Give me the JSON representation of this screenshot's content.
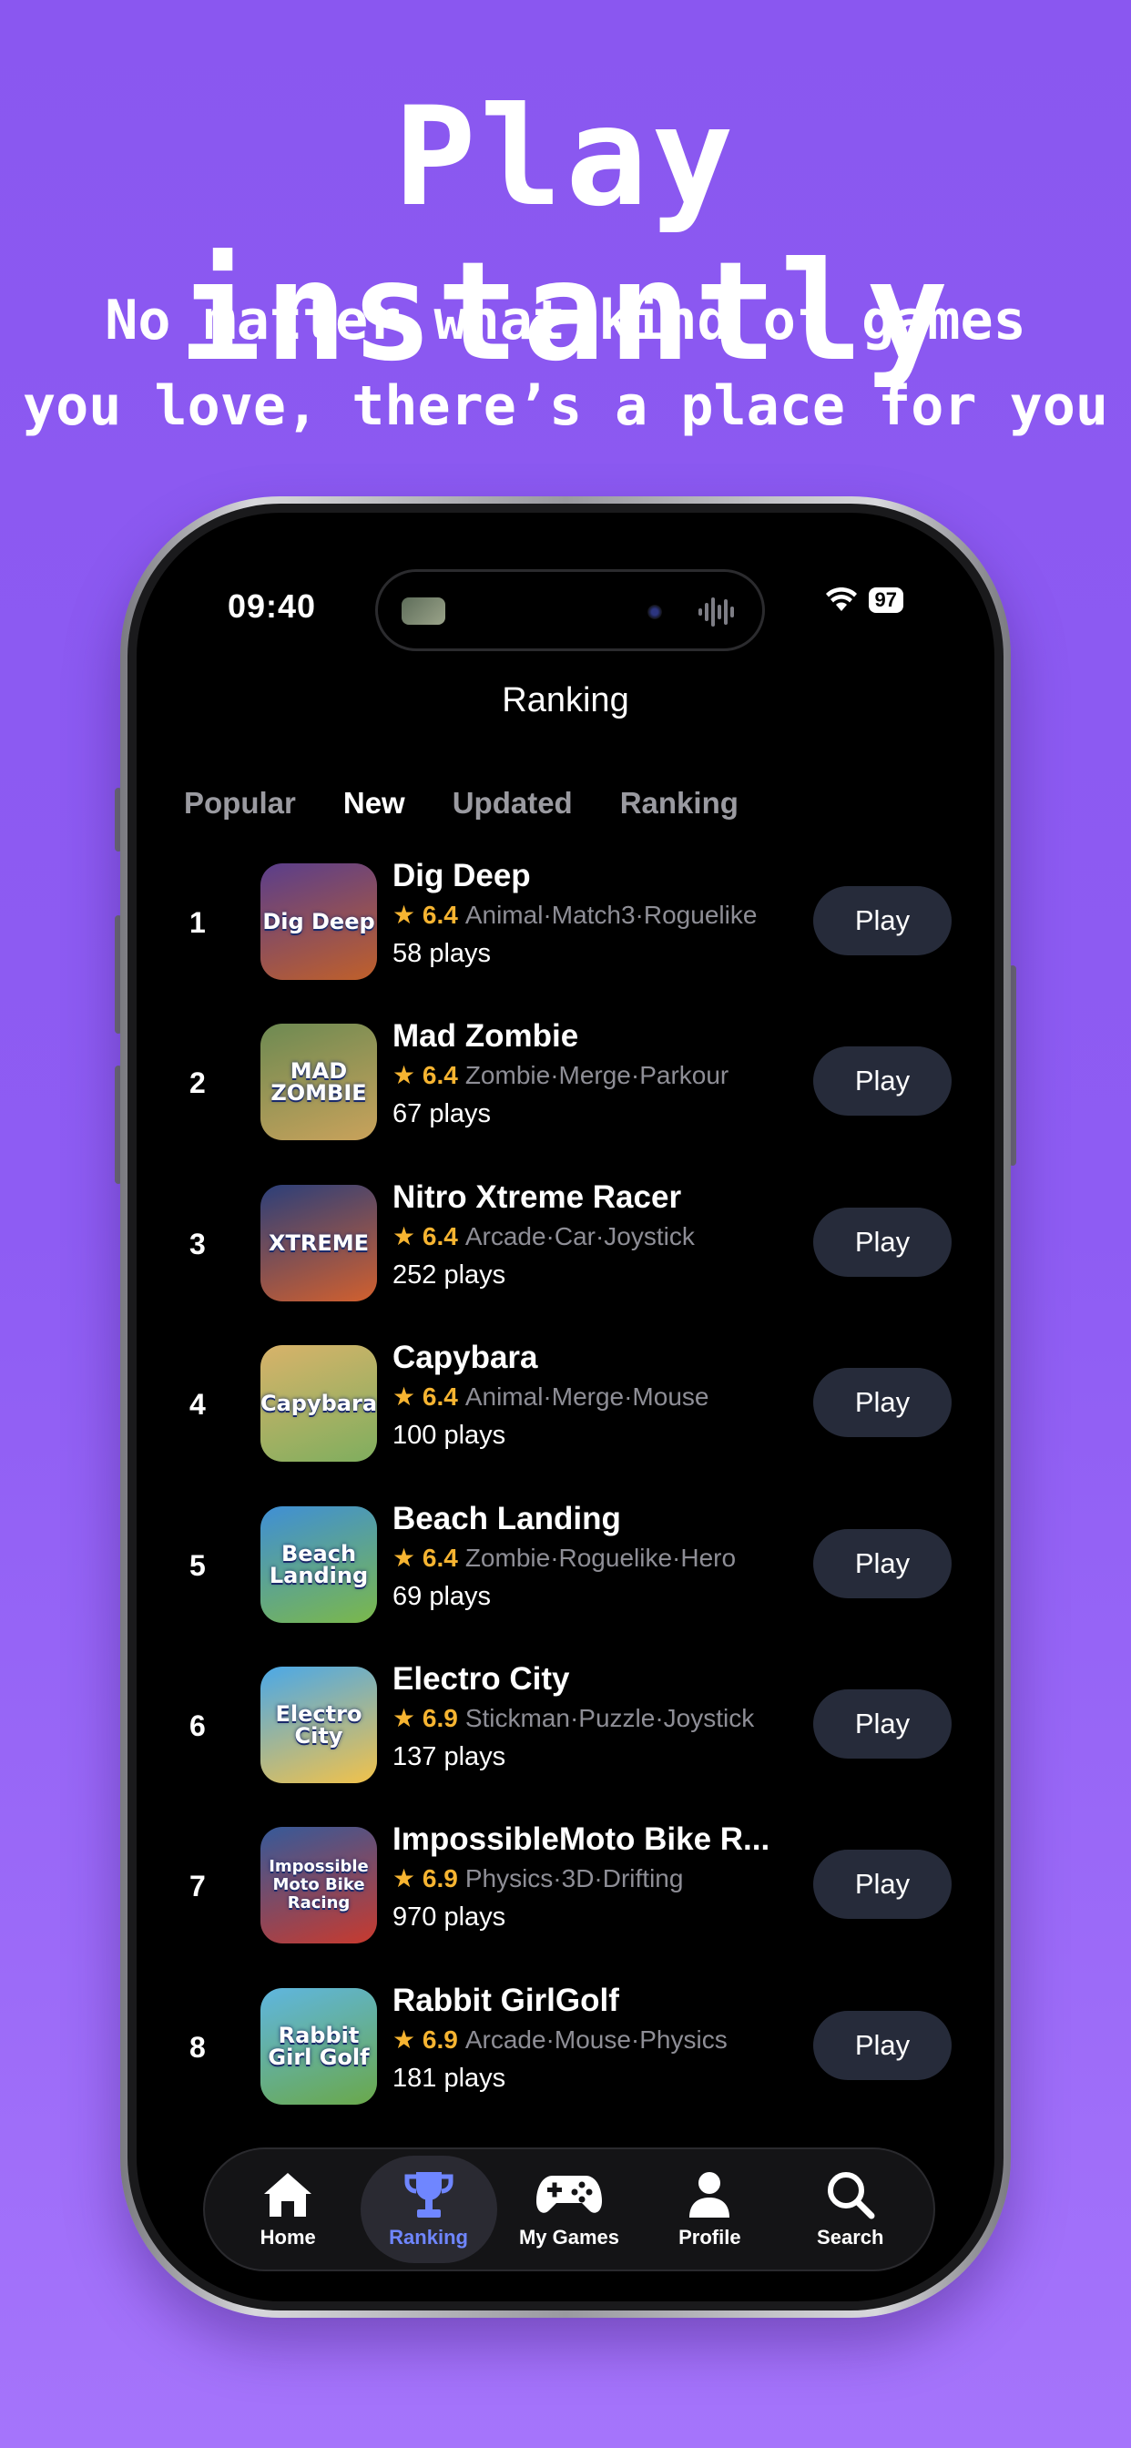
{
  "headline": "Play instantly",
  "subheadline_line1": "No matter what kind of games",
  "subheadline_line2": "you love, there’s a place for you",
  "status_bar": {
    "time": "09:40",
    "battery": "97"
  },
  "nav": {
    "title": "Ranking"
  },
  "tabs": [
    {
      "label": "Popular",
      "active": false
    },
    {
      "label": "New",
      "active": true
    },
    {
      "label": "Updated",
      "active": false
    },
    {
      "label": "Ranking",
      "active": false
    }
  ],
  "games": [
    {
      "rank": "1",
      "name": "Dig Deep",
      "thumb_text": "Dig Deep",
      "rating": "6.4",
      "tags": "Animal·Match3·Roguelike",
      "plays": "58 plays",
      "action": "Play"
    },
    {
      "rank": "2",
      "name": "Mad Zombie",
      "thumb_text": "MAD ZOMBIE",
      "rating": "6.4",
      "tags": "Zombie·Merge·Parkour",
      "plays": "67 plays",
      "action": "Play"
    },
    {
      "rank": "3",
      "name": "Nitro Xtreme Racer",
      "thumb_text": "XTREME",
      "rating": "6.4",
      "tags": "Arcade·Car·Joystick",
      "plays": "252 plays",
      "action": "Play"
    },
    {
      "rank": "4",
      "name": "Capybara",
      "thumb_text": "Capybara",
      "rating": "6.4",
      "tags": "Animal·Merge·Mouse",
      "plays": "100 plays",
      "action": "Play"
    },
    {
      "rank": "5",
      "name": "Beach Landing",
      "thumb_text": "Beach Landing",
      "rating": "6.4",
      "tags": "Zombie·Roguelike·Hero",
      "plays": "69 plays",
      "action": "Play"
    },
    {
      "rank": "6",
      "name": "Electro City",
      "thumb_text": "Electro City",
      "rating": "6.9",
      "tags": "Stickman·Puzzle·Joystick",
      "plays": "137 plays",
      "action": "Play"
    },
    {
      "rank": "7",
      "name": "ImpossibleMoto Bike R...",
      "thumb_text": "Impossible Moto Bike Racing",
      "rating": "6.9",
      "tags": "Physics·3D·Drifting",
      "plays": "970 plays",
      "action": "Play"
    },
    {
      "rank": "8",
      "name": "Rabbit GirlGolf",
      "thumb_text": "Rabbit Girl Golf",
      "rating": "6.9",
      "tags": "Arcade·Mouse·Physics",
      "plays": "181 plays",
      "action": "Play"
    }
  ],
  "thumb_colors": [
    [
      "#5a3e8c",
      "#c0602a"
    ],
    [
      "#6d8a52",
      "#c9a25b"
    ],
    [
      "#2b3f7a",
      "#d2602e"
    ],
    [
      "#d8b36a",
      "#7fae5e"
    ],
    [
      "#3f8fd6",
      "#7bb84a"
    ],
    [
      "#4aa8e8",
      "#f2c24a"
    ],
    [
      "#355a9a",
      "#c83a2e"
    ],
    [
      "#5fb6e0",
      "#6aa84a"
    ]
  ],
  "tabbar": [
    {
      "label": "Home",
      "icon": "home-icon",
      "active": false
    },
    {
      "label": "Ranking",
      "icon": "trophy-icon",
      "active": true
    },
    {
      "label": "My Games",
      "icon": "gamepad-icon",
      "active": false
    },
    {
      "label": "Profile",
      "icon": "person-icon",
      "active": false
    },
    {
      "label": "Search",
      "icon": "search-icon",
      "active": false
    }
  ],
  "colors": {
    "background_top": "#8a57f0",
    "background_bottom": "#a574fb",
    "rating_star": "#f6b431",
    "play_button": "#262b3a",
    "active_tab_accent": "#6f86ff"
  }
}
